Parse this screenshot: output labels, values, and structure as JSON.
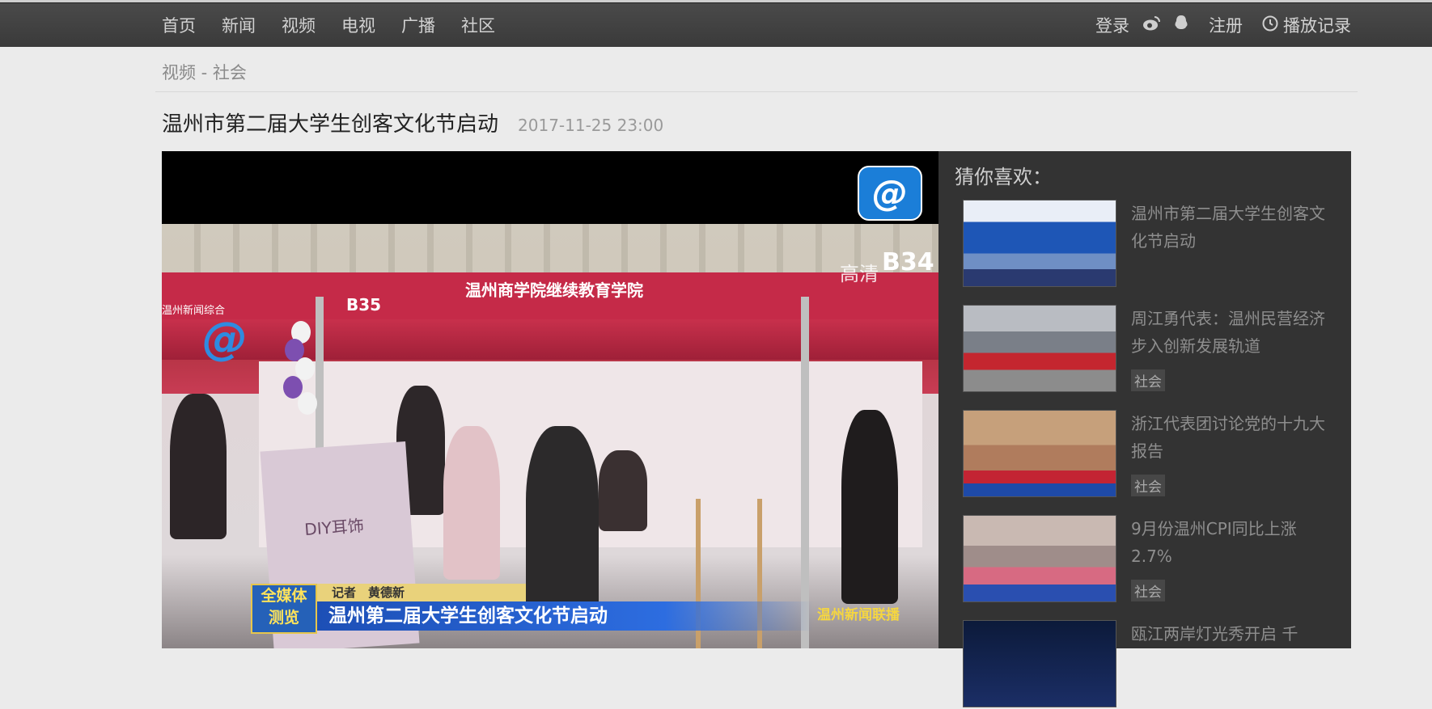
{
  "nav": {
    "items": [
      "首页",
      "新闻",
      "视频",
      "电视",
      "广播",
      "社区"
    ],
    "login": "登录",
    "register": "注册",
    "history": "播放记录"
  },
  "breadcrumb": "视频 - 社会",
  "video": {
    "title": "温州市第二届大学生创客文化节启动",
    "date": "2017-11-25 23:00",
    "overlay": {
      "booth_left": "B35",
      "booth_right": "B34",
      "hd_label": "高清",
      "banner": "温州商学院继续教育学院",
      "board_text": "DIY耳饰",
      "channel_sub": "温州新闻综合",
      "badge": "全媒体\n测览",
      "reporter": "记者　黄德新",
      "headline": "温州第二届大学生创客文化节启动",
      "program": "温州新闻联播"
    }
  },
  "recommend": {
    "title": "猜你喜欢：",
    "items": [
      {
        "text": "温州市第二届大学生创客文化节启动",
        "tag": ""
      },
      {
        "text": "周江勇代表：温州民营经济步入创新发展轨道",
        "tag": "社会"
      },
      {
        "text": "浙江代表团讨论党的十九大报告",
        "tag": "社会"
      },
      {
        "text": "9月份温州CPI同比上涨2.7%",
        "tag": "社会"
      },
      {
        "text": "瓯江两岸灯光秀开启 千",
        "tag": ""
      }
    ]
  }
}
